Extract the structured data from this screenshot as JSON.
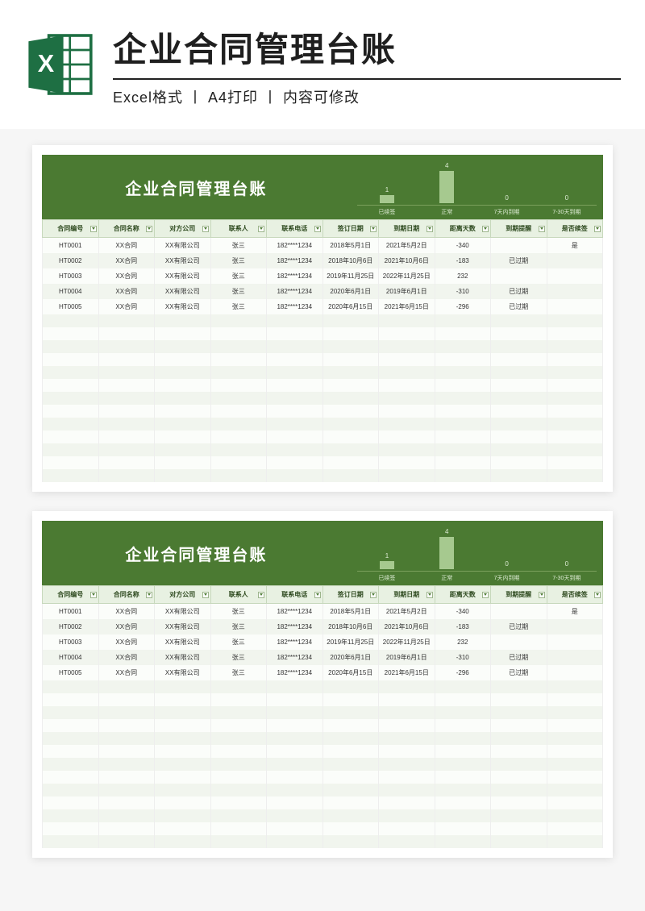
{
  "banner": {
    "main_title": "企业合同管理台账",
    "subtitle": "Excel格式 丨 A4打印 丨 内容可修改"
  },
  "sheet": {
    "title": "企业合同管理台账",
    "headers": [
      "合同编号",
      "合同名称",
      "对方公司",
      "联系人",
      "联系电话",
      "签订日期",
      "到期日期",
      "距离天数",
      "到期提醒",
      "是否续签"
    ],
    "rows": [
      {
        "id": "HT0001",
        "name": "XX合同",
        "company": "XX有限公司",
        "contact": "张三",
        "phone": "182****1234",
        "sign": "2018年5月1日",
        "due": "2021年5月2日",
        "days": "-340",
        "remind": "",
        "renew": "是"
      },
      {
        "id": "HT0002",
        "name": "XX合同",
        "company": "XX有限公司",
        "contact": "张三",
        "phone": "182****1234",
        "sign": "2018年10月6日",
        "due": "2021年10月6日",
        "days": "-183",
        "remind": "已过期",
        "renew": ""
      },
      {
        "id": "HT0003",
        "name": "XX合同",
        "company": "XX有限公司",
        "contact": "张三",
        "phone": "182****1234",
        "sign": "2019年11月25日",
        "due": "2022年11月25日",
        "days": "232",
        "remind": "",
        "renew": ""
      },
      {
        "id": "HT0004",
        "name": "XX合同",
        "company": "XX有限公司",
        "contact": "张三",
        "phone": "182****1234",
        "sign": "2020年6月1日",
        "due": "2019年6月1日",
        "days": "-310",
        "remind": "已过期",
        "renew": ""
      },
      {
        "id": "HT0005",
        "name": "XX合同",
        "company": "XX有限公司",
        "contact": "张三",
        "phone": "182****1234",
        "sign": "2020年6月15日",
        "due": "2021年6月15日",
        "days": "-296",
        "remind": "已过期",
        "renew": ""
      }
    ],
    "empty_rows": 13
  },
  "chart_data": {
    "type": "bar",
    "categories": [
      "已续签",
      "正常",
      "7天内到期",
      "7-30天到期"
    ],
    "values": [
      1,
      4,
      0,
      0
    ],
    "title": "",
    "xlabel": "",
    "ylabel": "",
    "ylim": [
      0,
      4
    ]
  }
}
